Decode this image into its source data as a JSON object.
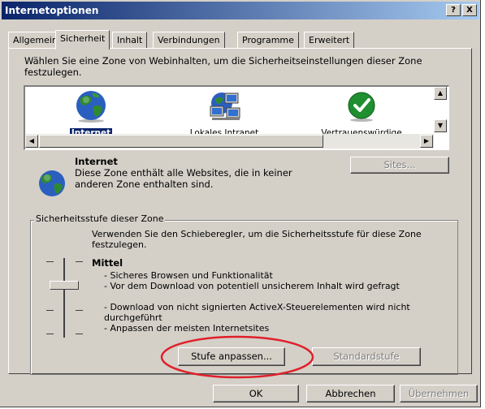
{
  "window": {
    "title": "Internetoptionen",
    "help_button": "?",
    "close_button": "X"
  },
  "tabs": [
    {
      "label": "Allgemein"
    },
    {
      "label": "Sicherheit"
    },
    {
      "label": "Inhalt"
    },
    {
      "label": "Verbindungen"
    },
    {
      "label": "Programme"
    },
    {
      "label": "Erweitert"
    }
  ],
  "intro_text": "Wählen Sie eine Zone von Webinhalten, um die Sicherheitseinstellungen dieser Zone festzulegen.",
  "zones": [
    {
      "label": "Internet",
      "icon": "globe-icon"
    },
    {
      "label": "Lokales Intranet",
      "icon": "computer-network-icon"
    },
    {
      "label": "Vertrauenswürdige",
      "icon": "checkmark-icon"
    }
  ],
  "selected_zone": {
    "name": "Internet",
    "description": "Diese Zone enthält alle Websites, die in keiner anderen Zone enthalten sind.",
    "sites_button": "Sites..."
  },
  "security_level": {
    "group_title": "Sicherheitsstufe dieser Zone",
    "instruction": "Verwenden Sie den Schieberegler, um die Sicherheitsstufe für diese Zone festzulegen.",
    "level_name": "Mittel",
    "bullets": [
      "- Sicheres Browsen und Funktionalität",
      "- Vor dem Download von potentiell unsicherem Inhalt wird gefragt",
      "- Download von nicht signierten ActiveX-Steuerelementen wird nicht durchgeführt",
      "- Anpassen der meisten Internetsites"
    ],
    "custom_button": "Stufe anpassen...",
    "default_button": "Standardstufe"
  },
  "footer": {
    "ok": "OK",
    "cancel": "Abbrechen",
    "apply": "Übernehmen"
  },
  "colors": {
    "titlebar_start": "#0a246a",
    "titlebar_end": "#a6caf0",
    "face": "#d4d0c8",
    "highlight_circle": "#e0202a",
    "selection": "#0a246a"
  }
}
